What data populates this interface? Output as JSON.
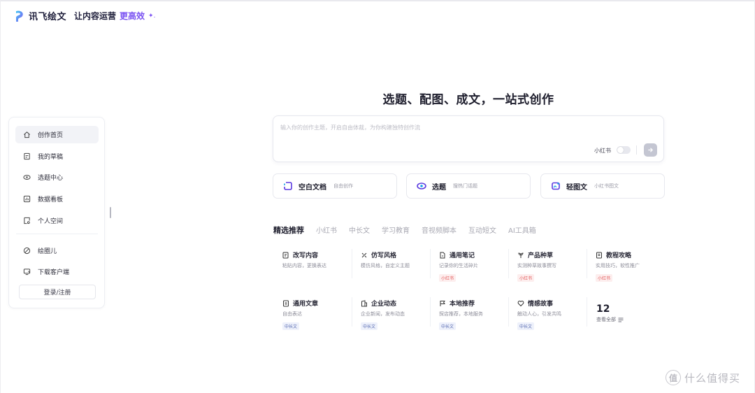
{
  "brand": {
    "name": "讯飞绘文",
    "slogan": "让内容运营",
    "slogan_accent": "更高效",
    "sparkle": "✦.",
    "accent_color": "#7a52f2"
  },
  "sidebar": {
    "items": [
      {
        "label": "创作首页",
        "icon": "home-icon"
      },
      {
        "label": "我的草稿",
        "icon": "draft-icon"
      },
      {
        "label": "选题中心",
        "icon": "eye-icon"
      },
      {
        "label": "数据看板",
        "icon": "chart-icon"
      },
      {
        "label": "个人空间",
        "icon": "space-icon"
      }
    ],
    "extra_items": [
      {
        "label": "绘圈儿",
        "icon": "circle-icon"
      },
      {
        "label": "下载客户端",
        "icon": "download-icon"
      }
    ],
    "login_label": "登录/注册"
  },
  "hero": {
    "title": "选题、配图、成文，一站式创作"
  },
  "prompt": {
    "placeholder": "输入你的创作主题，开启自由体裁，为你构建独特创作流",
    "xhs_toggle_label": "小红书",
    "xhs_toggle_on": false,
    "send_icon": "arrow-right-icon"
  },
  "modes": [
    {
      "title": "空白文档",
      "sub": "自由创作",
      "icon": "doc-icon"
    },
    {
      "title": "选题",
      "sub": "搜热门话题",
      "icon": "topic-eye-icon"
    },
    {
      "title": "轻图文",
      "sub": "小红书图文",
      "icon": "image-text-icon"
    }
  ],
  "tabs": [
    "精选推荐",
    "小红书",
    "中长文",
    "学习教育",
    "音视频脚本",
    "互动短文",
    "AI工具箱"
  ],
  "active_tab": "精选推荐",
  "templates_row1": [
    {
      "title": "改写内容",
      "desc": "粘贴内容，更换表达",
      "badge": "",
      "icon": "edit-icon"
    },
    {
      "title": "仿写风格",
      "desc": "模仿风格，自定义主题",
      "badge": "",
      "icon": "wand-icon"
    },
    {
      "title": "通用笔记",
      "desc": "记录你的生活碎片",
      "badge": "小红书",
      "icon": "note-icon"
    },
    {
      "title": "产品种草",
      "desc": "实测种草故事撰写",
      "badge": "小红书",
      "icon": "sprout-icon"
    },
    {
      "title": "教程攻略",
      "desc": "实用技巧，软性推广",
      "badge": "小红书",
      "icon": "guide-icon"
    }
  ],
  "templates_row2": [
    {
      "title": "通用文章",
      "desc": "自由表达",
      "badge": "中长文",
      "icon": "article-icon"
    },
    {
      "title": "企业动态",
      "desc": "企业新闻，发布动态",
      "badge": "中长文",
      "icon": "building-icon"
    },
    {
      "title": "本地推荐",
      "desc": "探店推荐，本地服务",
      "badge": "中长文",
      "icon": "flag-icon"
    },
    {
      "title": "情感故事",
      "desc": "触动人心，引发共鸣",
      "badge": "中长文",
      "icon": "heart-icon"
    }
  ],
  "more": {
    "count": "12",
    "label": "查看全部"
  },
  "watermark": {
    "badge": "值",
    "text": "什么值得买"
  }
}
